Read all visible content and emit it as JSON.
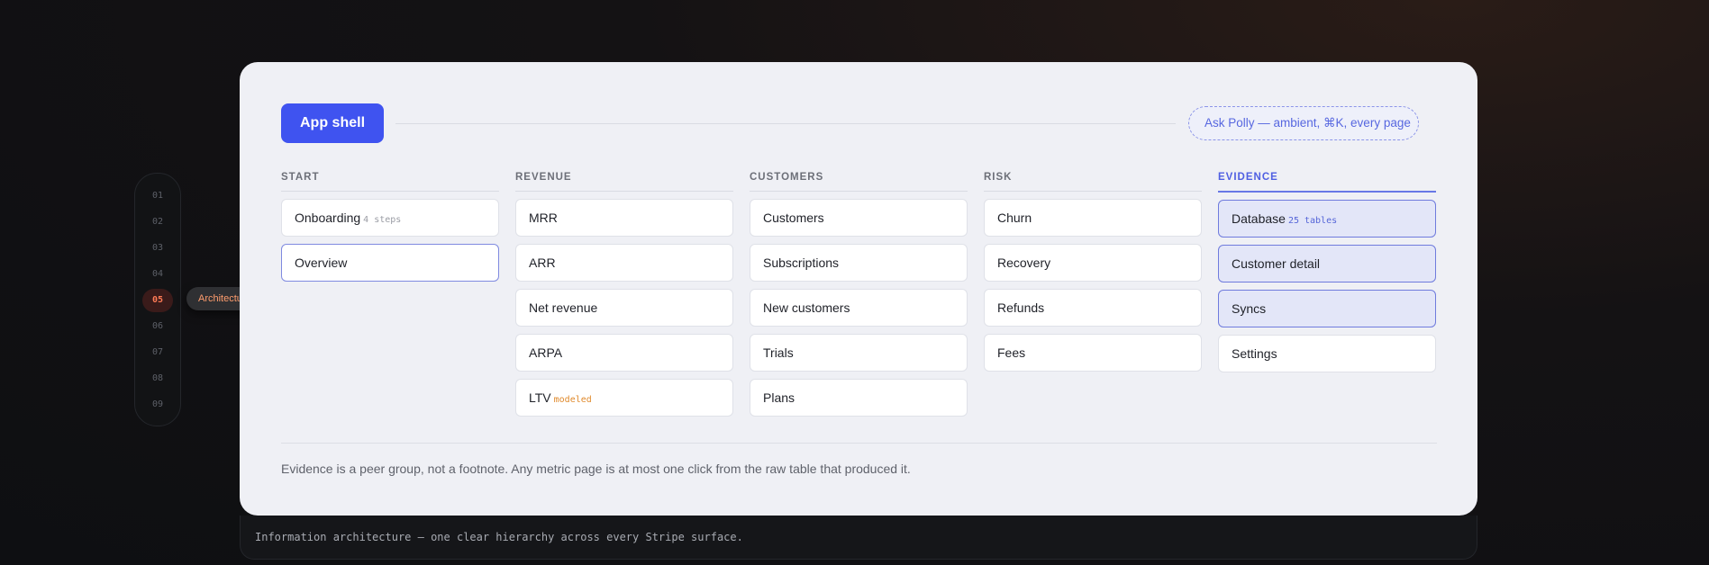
{
  "rail": {
    "steps": [
      "01",
      "02",
      "03",
      "04",
      "05",
      "06",
      "07",
      "08",
      "09"
    ],
    "active_index": 4,
    "active_label": "Architecture"
  },
  "header": {
    "app_shell_label": "App shell",
    "ask_polly": "Ask Polly — ambient, ⌘K, every page"
  },
  "columns": [
    {
      "title": "START",
      "items": [
        {
          "label": "Onboarding",
          "tag": "4 steps",
          "tag_color": "grey"
        },
        {
          "label": "Overview",
          "selected": true
        }
      ]
    },
    {
      "title": "REVENUE",
      "items": [
        {
          "label": "MRR"
        },
        {
          "label": "ARR"
        },
        {
          "label": "Net revenue"
        },
        {
          "label": "ARPA"
        },
        {
          "label": "LTV",
          "tag": "modeled",
          "tag_color": "orange"
        }
      ]
    },
    {
      "title": "CUSTOMERS",
      "items": [
        {
          "label": "Customers"
        },
        {
          "label": "Subscriptions"
        },
        {
          "label": "New customers"
        },
        {
          "label": "Trials"
        },
        {
          "label": "Plans"
        }
      ]
    },
    {
      "title": "RISK",
      "items": [
        {
          "label": "Churn"
        },
        {
          "label": "Recovery"
        },
        {
          "label": "Refunds"
        },
        {
          "label": "Fees"
        }
      ]
    },
    {
      "title": "EVIDENCE",
      "highlight": true,
      "items": [
        {
          "label": "Database",
          "tag": "25 tables",
          "tag_color": "blue",
          "evidence": true
        },
        {
          "label": "Customer detail",
          "evidence": true
        },
        {
          "label": "Syncs",
          "evidence": true
        },
        {
          "label": "Settings"
        }
      ]
    }
  ],
  "footer_note": "Evidence is a peer group, not a footnote. Any metric page is at most one click from the raw table that produced it.",
  "caption": "Information architecture — one clear hierarchy across every Stripe surface.",
  "colors": {
    "accent": "#3f53f0",
    "evidence": "#4f5fe2",
    "rail_active": "#ff7a55"
  }
}
